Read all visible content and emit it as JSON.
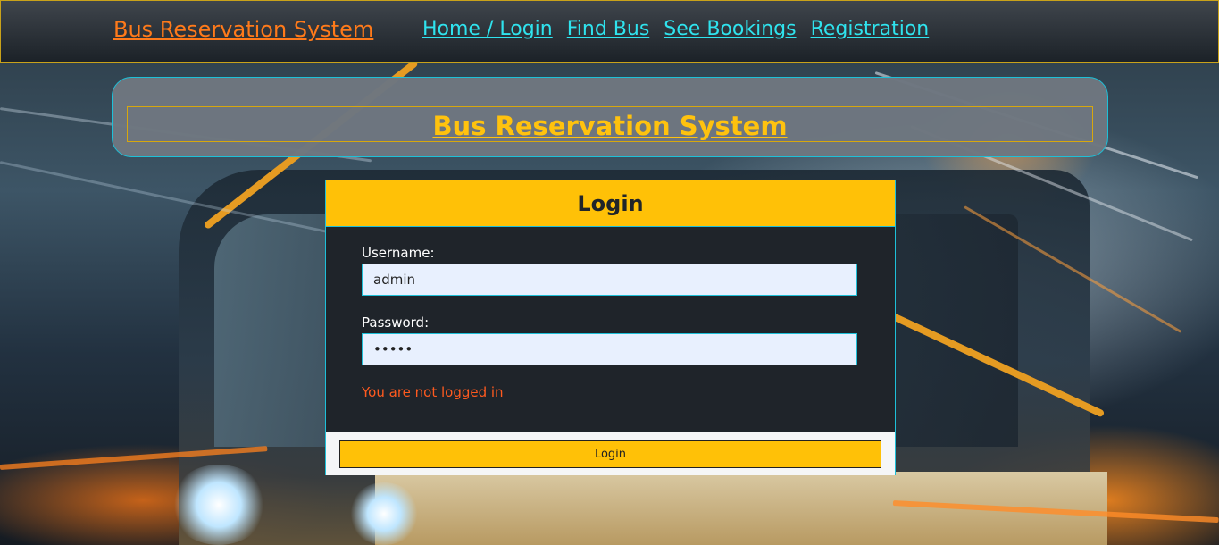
{
  "navbar": {
    "brand": "Bus Reservation System",
    "links": [
      "Home / Login",
      "Find Bus",
      "See Bookings",
      "Registration"
    ]
  },
  "banner": {
    "title": "Bus Reservation System"
  },
  "login": {
    "title": "Login",
    "username_label": "Username:",
    "username_value": "admin",
    "password_label": "Password:",
    "password_value": "•••••",
    "status_message": "You are not logged in",
    "button_label": "Login"
  },
  "colors": {
    "brand": "#ff7a1a",
    "nav_link": "#2fe3ee",
    "accent": "#ffc107",
    "error": "#ff5a1f",
    "border": "#1ec0d8"
  }
}
